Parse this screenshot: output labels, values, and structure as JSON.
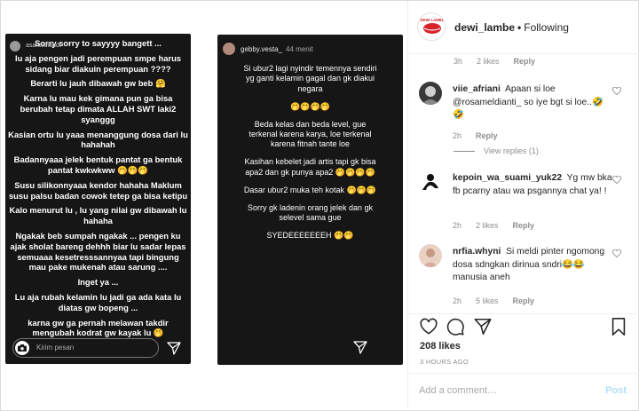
{
  "story_left": {
    "overlay_name": "asanaidiandt",
    "lines": [
      "Sorry sorry to sayyyy bangett ...",
      "lu aja pengen jadi perempuan smpe harus sidang biar diakuin perempuan ????",
      "Berarti lu jauh dibawah gw beb 🤗",
      "Karna lu mau kek gimana pun ga bisa berubah tetap dimata ALLAH SWT laki2 syanggg",
      "Kasian ortu lu yaaa menanggung dosa dari lu hahahah",
      "Badannyaaa jelek bentuk pantat ga bentuk pantat kwkwkww 🤭🤭🤭",
      "Susu silikonnyaaa kendor hahaha Maklum susu palsu badan cowok tetep ga bisa ketipu",
      "Kalo menurut lu , lu yang nilai gw dibawah lu hahaha",
      "Ngakak beb sumpah ngakak ... pengen ku ajak sholat bareng dehhh biar lu sadar lepas semuaaa kesetresssannyaa tapi bingung mau pake mukenah atau sarung ....",
      "Inget ya ...",
      "Lu aja rubah kelamin lu jadi ga ada kata lu diatas gw bopeng ...",
      "karna gw ga pernah melawan takdir mengubah kodrat gw kayak lu 🤭"
    ],
    "reply_placeholder": "Kirim pesan"
  },
  "story_right": {
    "username": "gebby.vesta_",
    "time": "44 menit",
    "lines": [
      "Si ubur2 lagi nyindir temennya sendiri yg ganti kelamin gagal dan gk diakui negara",
      "🤭🤭🤭🤭",
      "Beda kelas dan beda level, gue terkenal karena karya, loe terkenal karena fitnah tante loe",
      "Kasihan kebelet jadi artis tapi gk bisa apa2 dan gk punya apa2 🤭🤭🤭🤭",
      "Dasar ubur2 muka teh kotak 🤭🤭🤭",
      "Sorry gk ladenin orang jelek dan gk selevel sama gue",
      "SYEDEEEEEEEH 🤭🤭"
    ]
  },
  "header": {
    "username": "dewi_lambe",
    "separator": "•",
    "follow_status": "Following",
    "avatar_text": "DEWI LAMBE"
  },
  "comments": {
    "top_meta": {
      "time": "3h",
      "likes": "2 likes",
      "reply": "Reply"
    },
    "items": [
      {
        "user": "viie_afriani",
        "text": "Apaan si loe @rosameldianti_ so iye bgt si loe..🤣🤣",
        "time": "2h",
        "likes": "",
        "reply": "Reply",
        "view_replies": "View replies (1)"
      },
      {
        "user": "kepoin_wa_suami_yuk22",
        "text": "Yg mw bka fb pcarny atau wa psgannya chat ya! !",
        "time": "2h",
        "likes": "2 likes",
        "reply": "Reply"
      },
      {
        "user": "nrfia.whyni",
        "text": "Si meldi pinter ngomong dosa sdngkan dirinua sndri😂😂 manusia aneh",
        "time": "2h",
        "likes": "5 likes",
        "reply": "Reply"
      }
    ]
  },
  "likes_count": "208 likes",
  "time_ago": "3 HOURS AGO",
  "add_comment": {
    "placeholder": "Add a comment…",
    "post_label": "Post"
  },
  "colors": {
    "link": "#003569",
    "post_disabled": "#b2dffc",
    "story_bg": "#161616"
  }
}
